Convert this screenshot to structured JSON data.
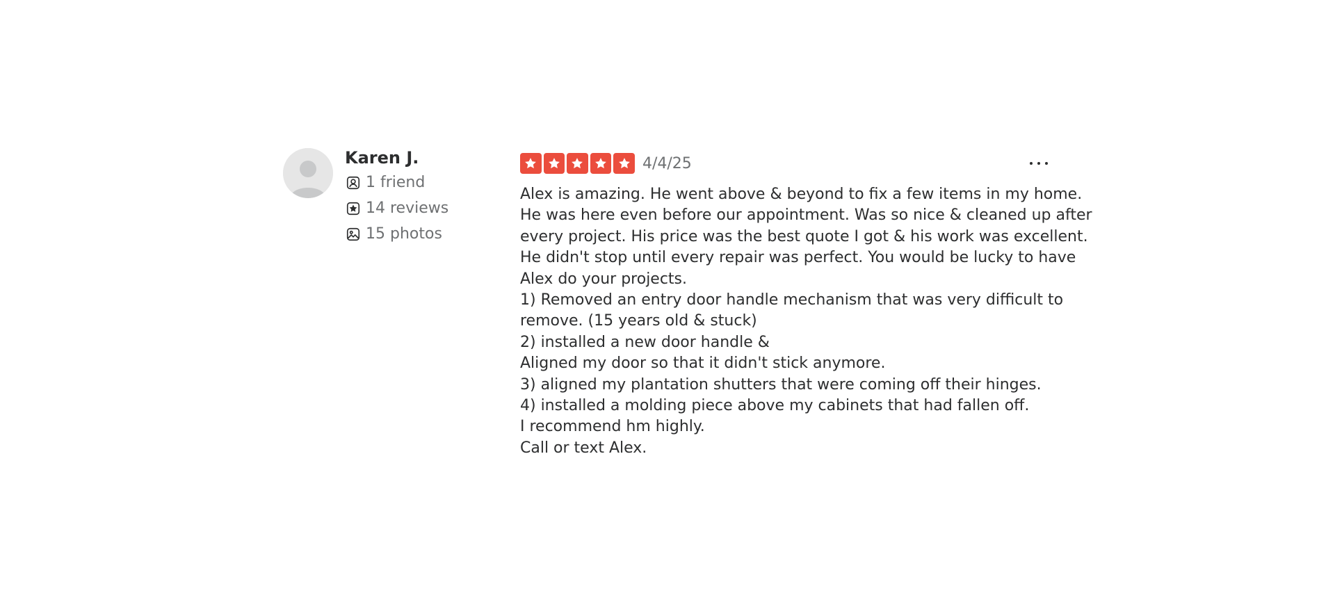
{
  "review": {
    "user": {
      "name": "Karen J.",
      "avatar_icon": "default-avatar-icon",
      "stats": [
        {
          "icon": "friends-icon",
          "label": "1 friend"
        },
        {
          "icon": "reviews-icon",
          "label": "14 reviews"
        },
        {
          "icon": "photos-icon",
          "label": "15 photos"
        }
      ]
    },
    "rating": 5,
    "max_rating": 5,
    "star_color": "#eb4d3d",
    "date": "4/4/25",
    "more_icon": "more-options-icon",
    "text_lines": [
      "Alex is amazing. He went above & beyond to fix a few items in my home.",
      "He was here even before our appointment. Was so nice & cleaned up after",
      "every project. His price was the best quote I got & his work was excellent.",
      "He didn't stop until every repair was perfect. You would be lucky to have",
      "Alex do your projects.",
      "1) Removed an entry door handle mechanism that was very difficult to",
      "remove. (15 years old & stuck)",
      "2) installed a new door handle &",
      "Aligned my door so that it didn't stick anymore.",
      "3) aligned my plantation shutters that were coming off their hinges.",
      "4) installed a molding piece above my cabinets that had fallen off.",
      "I recommend hm highly.",
      "Call or text Alex."
    ]
  }
}
